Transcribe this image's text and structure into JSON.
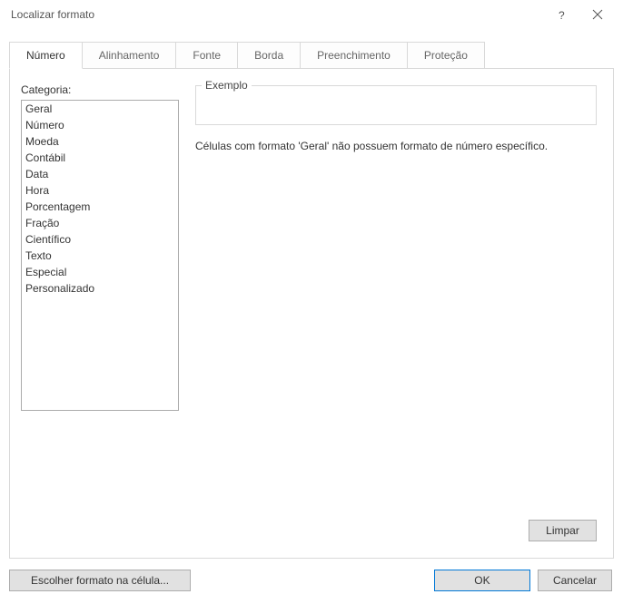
{
  "titlebar": {
    "title": "Localizar formato"
  },
  "tabs": {
    "items": [
      {
        "label": "Número"
      },
      {
        "label": "Alinhamento"
      },
      {
        "label": "Fonte"
      },
      {
        "label": "Borda"
      },
      {
        "label": "Preenchimento"
      },
      {
        "label": "Proteção"
      }
    ]
  },
  "category": {
    "label": "Categoria:",
    "items": [
      "Geral",
      "Número",
      "Moeda",
      "Contábil",
      "Data",
      "Hora",
      "Porcentagem",
      "Fração",
      "Científico",
      "Texto",
      "Especial",
      "Personalizado"
    ]
  },
  "example": {
    "legend": "Exemplo"
  },
  "description": "Células com formato 'Geral' não possuem formato de número específico.",
  "buttons": {
    "clear": "Limpar",
    "choose": "Escolher formato na célula...",
    "ok": "OK",
    "cancel": "Cancelar"
  }
}
